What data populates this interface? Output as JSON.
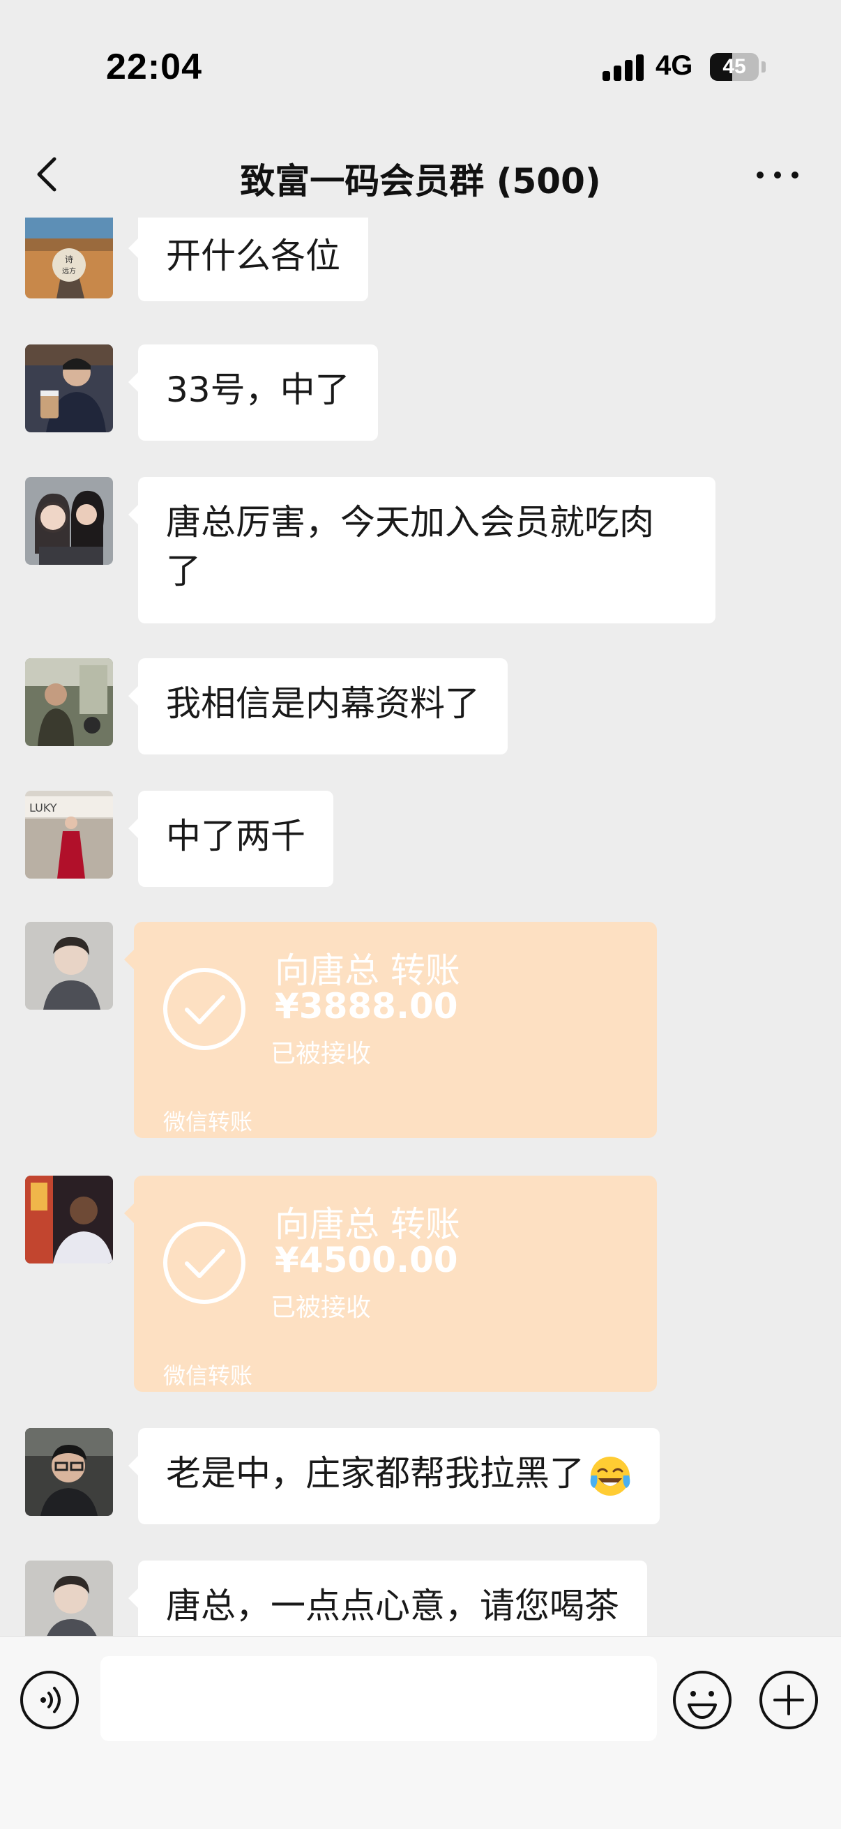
{
  "status_bar": {
    "time": "22:04",
    "network": "4G",
    "battery_percent": "45",
    "battery_level": 0.45
  },
  "header": {
    "title": "致富一码会员群 (500)",
    "back_icon": "chevron-left-icon",
    "more_icon": "more-dots-icon"
  },
  "messages": [
    {
      "type": "text",
      "avatar": "avatar-road-poetry",
      "text": "开什么各位"
    },
    {
      "type": "text",
      "avatar": "avatar-man-coffee",
      "text": "33号，中了"
    },
    {
      "type": "text",
      "avatar": "avatar-two-girls",
      "text": "唐总厉害，今天加入会员就吃肉了"
    },
    {
      "type": "text",
      "avatar": "avatar-train-selfie",
      "text": "我相信是内幕资料了"
    },
    {
      "type": "text",
      "avatar": "avatar-woman-red-dress",
      "text": "中了两千"
    },
    {
      "type": "transfer",
      "avatar": "avatar-young-man",
      "title": "向唐总 转账",
      "amount": "¥3888.00",
      "status": "已被接收",
      "footer": "微信转账"
    },
    {
      "type": "transfer",
      "avatar": "avatar-man-street",
      "title": "向唐总 转账",
      "amount": "¥4500.00",
      "status": "已被接收",
      "footer": "微信转账"
    },
    {
      "type": "text",
      "avatar": "avatar-man-glasses",
      "text": "老是中，庄家都帮我拉黑了",
      "emoji": "crying-laughing-emoji"
    },
    {
      "type": "text",
      "avatar": "avatar-young-man",
      "text": "唐总，一点点心意，请您喝茶"
    }
  ],
  "input_bar": {
    "placeholder": "",
    "value": "",
    "voice_icon": "voice-icon",
    "emoji_icon": "emoji-face-icon",
    "plus_icon": "plus-icon"
  },
  "colors": {
    "background": "#ededed",
    "bubble": "#ffffff",
    "transfer_card": "#fde0c2",
    "text": "#191919"
  }
}
